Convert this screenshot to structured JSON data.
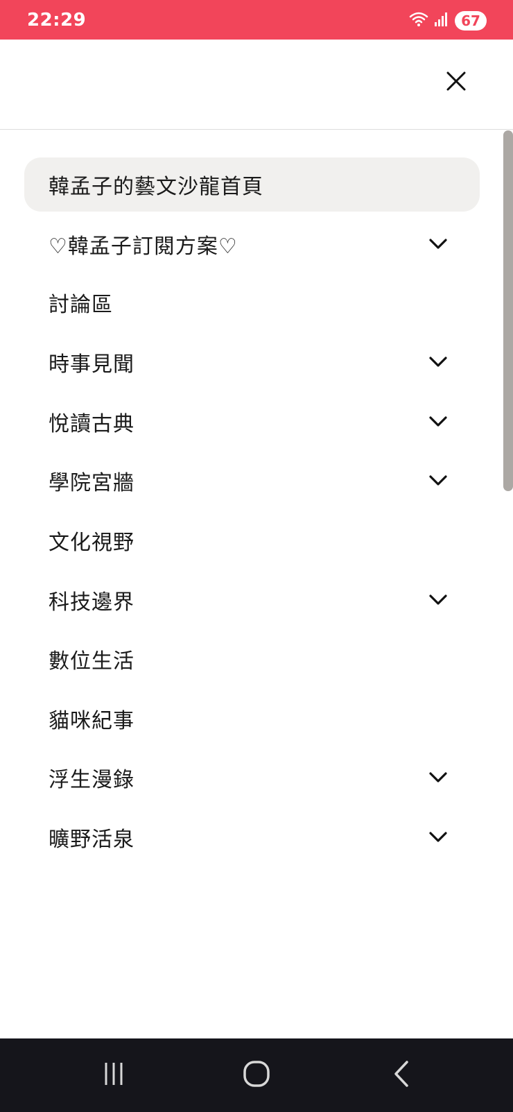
{
  "status_bar": {
    "time": "22:29",
    "battery": "67",
    "icons": [
      "wifi-icon",
      "signal-icon",
      "battery-icon"
    ],
    "color": "#f2455a"
  },
  "header": {
    "close_icon": "close-icon"
  },
  "menu": {
    "items": [
      {
        "label": "韓孟子的藝文沙龍首頁",
        "expandable": false,
        "active": true
      },
      {
        "label": "♡韓孟子訂閱方案♡",
        "expandable": true,
        "active": false
      },
      {
        "label": "討論區",
        "expandable": false,
        "active": false
      },
      {
        "label": "時事見聞",
        "expandable": true,
        "active": false
      },
      {
        "label": "悅讀古典",
        "expandable": true,
        "active": false
      },
      {
        "label": "學院宮牆",
        "expandable": true,
        "active": false
      },
      {
        "label": "文化視野",
        "expandable": false,
        "active": false
      },
      {
        "label": "科技邊界",
        "expandable": true,
        "active": false
      },
      {
        "label": "數位生活",
        "expandable": false,
        "active": false
      },
      {
        "label": "貓咪紀事",
        "expandable": false,
        "active": false
      },
      {
        "label": "浮生漫錄",
        "expandable": true,
        "active": false
      },
      {
        "label": "曠野活泉",
        "expandable": true,
        "active": false
      }
    ]
  },
  "nav_bar": {
    "buttons": [
      "recent-apps-icon",
      "home-icon",
      "back-icon"
    ]
  }
}
